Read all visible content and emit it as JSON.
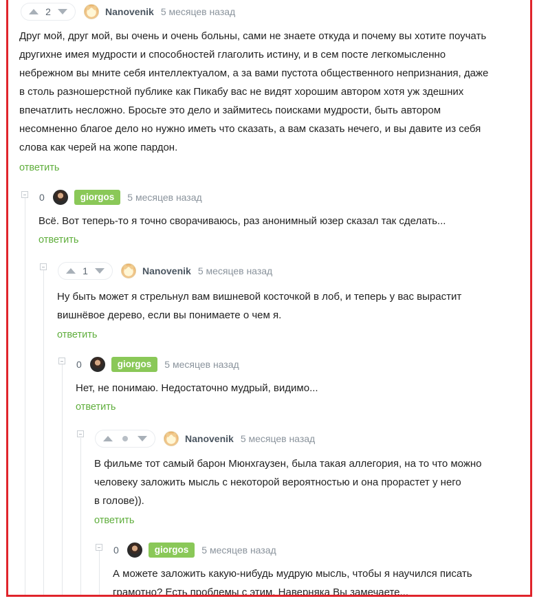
{
  "reply_label": "ответить",
  "comments": [
    {
      "score": "2",
      "author": "Nanovenik",
      "time": "5 месяцев назад",
      "lines": [
        "Друг мой, друг мой, вы очень и очень больны, сами не знаете откуда и почему вы хотите поучать",
        "другихне имея мудрости и способностей глаголить истину, и в сем посте легкомысленно",
        "небрежном вы мните себя интеллектуалом, а за вами пустота общественного непризнания, даже",
        "в столь разношерстной публике как Пикабу вас не видят хорошим автором хотя уж здешних",
        "впечатлить несложно. Бросьте это дело и займитесь поисками мудрости, быть автором",
        "несомненно благое дело но нужно иметь что сказать, а вам сказать нечего, и вы давите из себя",
        "слова как черей на жопе пардон."
      ]
    },
    {
      "score": "0",
      "author": "giorgos",
      "time": "5 месяцев назад",
      "lines": [
        "Всё. Вот теперь-то я точно сворачиваюсь, раз анонимный юзер сказал так сделать..."
      ]
    },
    {
      "score": "1",
      "author": "Nanovenik",
      "time": "5 месяцев назад",
      "lines": [
        "Ну быть может я стрельнул вам вишневой косточкой в лоб, и теперь у вас вырастит",
        "вишнёвое дерево, если вы понимаете о чем я."
      ]
    },
    {
      "score": "0",
      "author": "giorgos",
      "time": "5 месяцев назад",
      "lines": [
        "Нет, не понимаю. Недостаточно мудрый, видимо..."
      ]
    },
    {
      "score": "",
      "author": "Nanovenik",
      "time": "5 месяцев назад",
      "lines": [
        "В фильме тот самый барон Мюнхгаузен, была такая аллегория, на то что можно",
        "человеку заложить мысль с некоторой вероятностью и она прорастет у него",
        "в голове))."
      ]
    },
    {
      "score": "0",
      "author": "giorgos",
      "time": "5 месяцев назад",
      "lines": [
        "А можете заложить какую-нибудь мудрую мысль, чтобы я научился писать",
        "грамотно? Есть проблемы с этим. Наверняка Вы замечаете..."
      ]
    }
  ]
}
